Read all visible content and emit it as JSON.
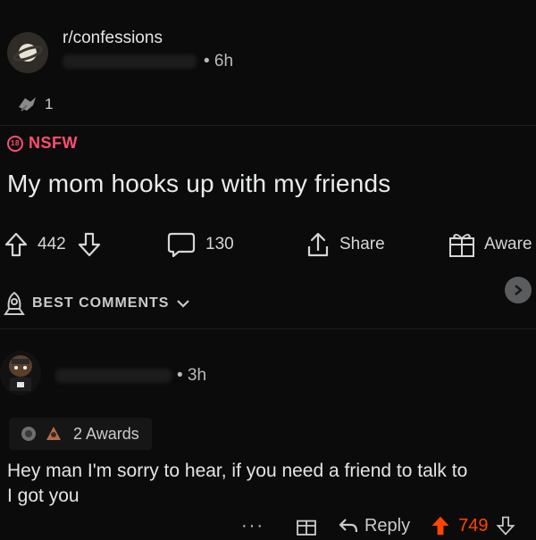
{
  "post": {
    "subreddit": "r/confessions",
    "time": "• 6h",
    "award_count": "1",
    "nsfw_label": "NSFW",
    "title": "My mom hooks up with my friends",
    "upvotes": "442",
    "comments": "130",
    "share_label": "Share",
    "award_label": "Aware"
  },
  "sort": {
    "label": "BEST COMMENTS"
  },
  "comment": {
    "time": "• 3h",
    "awards_label": "2 Awards",
    "body": "Hey man I'm sorry to hear, if you need a friend to talk to\nI got you",
    "more": "···",
    "reply_label": "Reply",
    "score": "749"
  },
  "colors": {
    "nsfw": "#ff4e70",
    "upvoted": "#ff4500",
    "background": "#0b0b0b"
  },
  "icons": [
    "planet-icon",
    "award-icon",
    "nsfw-icon",
    "upvote-icon",
    "downvote-icon",
    "comment-icon",
    "share-icon",
    "gift-icon",
    "rocket-icon",
    "chevron-down-icon",
    "chevron-right-icon",
    "reply-icon"
  ]
}
